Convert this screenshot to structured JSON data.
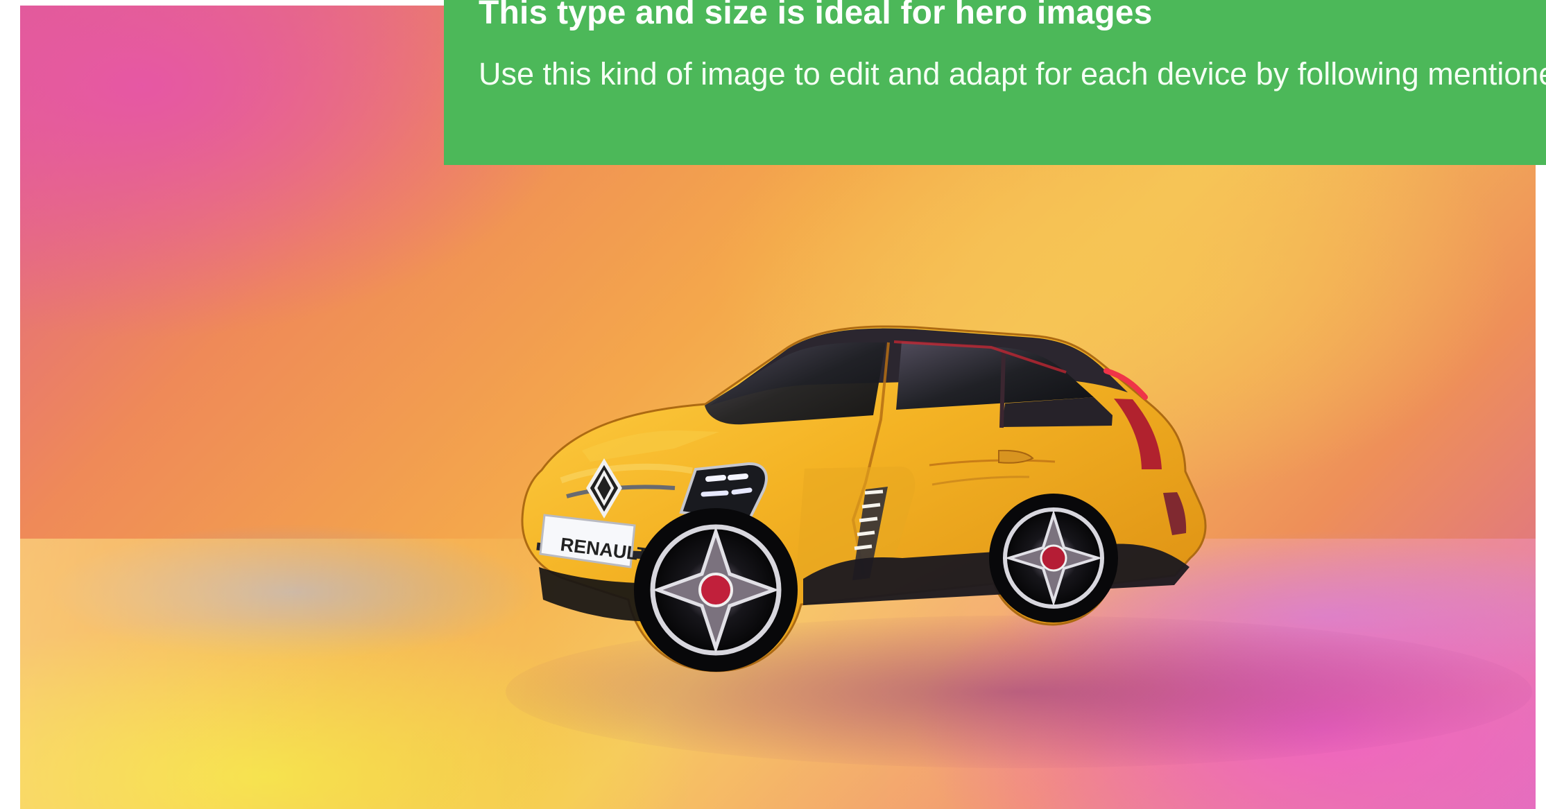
{
  "panel": {
    "title": "This type and size is ideal for hero images",
    "body": "Use this kind of image to edit and adapt for each device by following mentioned."
  },
  "hero": {
    "license_plate": "RENAULT 5"
  },
  "colors": {
    "panel_background": "#4cb859",
    "car_yellow": "#f2b321",
    "background_pink": "#de5e91",
    "background_orange": "#f4a84b",
    "background_magenta": "#d564a1"
  },
  "icons": {
    "brand_emblem": "renault-logo-icon"
  }
}
